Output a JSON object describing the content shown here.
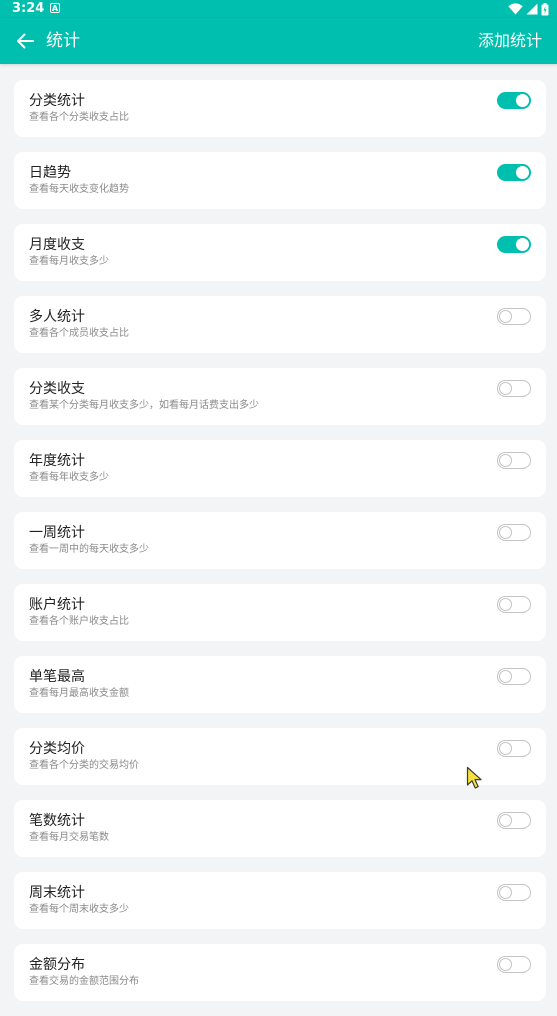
{
  "status_bar": {
    "time": "3:24",
    "notification_letter": "A"
  },
  "app_bar": {
    "title": "统计",
    "action_label": "添加统计"
  },
  "colors": {
    "accent": "#00bfae",
    "background": "#f3f4f6",
    "card": "#ffffff"
  },
  "items": [
    {
      "name": "分类统计",
      "desc": "查看各个分类收支占比",
      "enabled": true
    },
    {
      "name": "日趋势",
      "desc": "查看每天收支变化趋势",
      "enabled": true
    },
    {
      "name": "月度收支",
      "desc": "查看每月收支多少",
      "enabled": true
    },
    {
      "name": "多人统计",
      "desc": "查看各个成员收支占比",
      "enabled": false
    },
    {
      "name": "分类收支",
      "desc": "查看某个分类每月收支多少，如看每月话费支出多少",
      "enabled": false
    },
    {
      "name": "年度统计",
      "desc": "查看每年收支多少",
      "enabled": false
    },
    {
      "name": "一周统计",
      "desc": "查看一周中的每天收支多少",
      "enabled": false
    },
    {
      "name": "账户统计",
      "desc": "查看各个账户收支占比",
      "enabled": false
    },
    {
      "name": "单笔最高",
      "desc": "查看每月最高收支金额",
      "enabled": false
    },
    {
      "name": "分类均价",
      "desc": "查看各个分类的交易均价",
      "enabled": false
    },
    {
      "name": "笔数统计",
      "desc": "查看每月交易笔数",
      "enabled": false
    },
    {
      "name": "周末统计",
      "desc": "查看每个周末收支多少",
      "enabled": false
    },
    {
      "name": "金额分布",
      "desc": "查看交易的金额范围分布",
      "enabled": false
    }
  ]
}
